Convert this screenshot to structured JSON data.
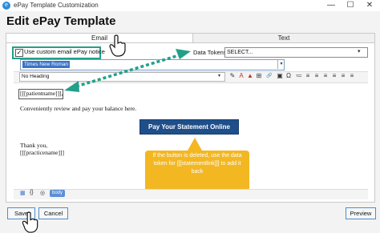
{
  "window": {
    "title": "ePay Template Customization",
    "app_icon": "e",
    "minimize": "—",
    "maximize": "☐",
    "close": "✕"
  },
  "page": {
    "heading": "Edit ePay Template"
  },
  "tabs": [
    {
      "label": "Email"
    },
    {
      "label": "Text"
    }
  ],
  "notice": {
    "label": "Use custom email ePay notice",
    "checked": true,
    "check_glyph": "✓"
  },
  "tokens": {
    "label": "Data Tokens:",
    "value": "SELECT...",
    "arrow": "▾"
  },
  "editor": {
    "font": "Times New Roman",
    "font_arrow": "▾",
    "heading_select": "No Heading",
    "heading_arrow": "▾",
    "tools": [
      "✎",
      "A",
      "▲",
      "⊞",
      "🔗",
      "▣",
      "Ω",
      "≔",
      "≡",
      "≡",
      "≡",
      "≡",
      "≡",
      "≡"
    ],
    "lines": {
      "token": "[[[patientname]]],",
      "intro": "Conveniently review and pay your balance here.",
      "thanks": "Thank you,",
      "signoff": "[[[practicename]]]"
    },
    "pay_button": "Pay Your Statement Online",
    "bottom_icons": [
      "▦",
      "{}",
      "◎"
    ],
    "body_tag": "body"
  },
  "callout": {
    "text": "If the button is deleted, use the data token for [[[statementlink]]] to add it back"
  },
  "buttons": {
    "save": "Save",
    "cancel": "Cancel",
    "preview": "Preview"
  },
  "colors": {
    "highlight": "#23a08a",
    "callout": "#f3b722",
    "pay_button": "#1f4f8a",
    "accent": "#4a8fd0"
  }
}
